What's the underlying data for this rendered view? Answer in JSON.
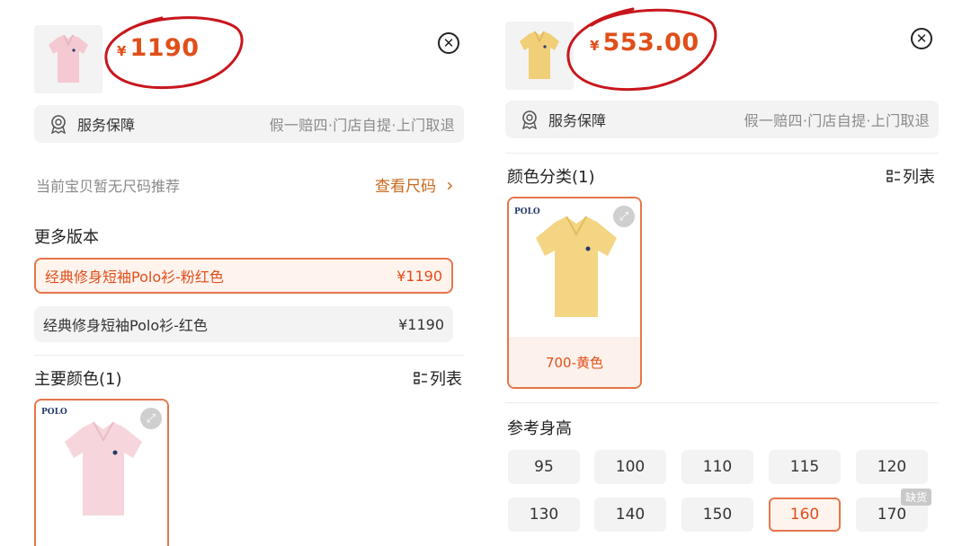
{
  "left": {
    "price": {
      "currency": "¥",
      "amount": "1190"
    },
    "close_icon": "close-circle-icon",
    "service": {
      "label": "服务保障",
      "detail": "假一赔四·门店自提·上门取退"
    },
    "size_recommend": {
      "text": "当前宝贝暂无尺码推荐",
      "link": "查看尺码",
      "link_arrow": "›"
    },
    "more_versions": {
      "title": "更多版本",
      "items": [
        {
          "name": "经典修身短袖Polo衫-粉红色",
          "price": "¥1190",
          "selected": true
        },
        {
          "name": "经典修身短袖Polo衫-红色",
          "price": "¥1190",
          "selected": false
        }
      ]
    },
    "main_color": {
      "title": "主要颜色(1)",
      "toggle": "列表",
      "brand": "POLO",
      "swatch_color": "#f6d6dc"
    }
  },
  "right": {
    "price": {
      "currency": "¥",
      "amount": "553.00"
    },
    "close_icon": "close-circle-icon",
    "service": {
      "label": "服务保障",
      "detail": "假一赔四·门店自提·上门取退"
    },
    "color_category": {
      "title": "颜色分类(1)",
      "toggle": "列表",
      "brand": "POLO",
      "caption": "700-黄色",
      "swatch_color": "#f3d584"
    },
    "height": {
      "title": "参考身高",
      "options": [
        {
          "label": "95",
          "selected": false
        },
        {
          "label": "100",
          "selected": false
        },
        {
          "label": "110",
          "selected": false
        },
        {
          "label": "115",
          "selected": false
        },
        {
          "label": "120",
          "selected": false
        },
        {
          "label": "130",
          "selected": false
        },
        {
          "label": "140",
          "selected": false
        },
        {
          "label": "150",
          "selected": false
        },
        {
          "label": "160",
          "selected": true
        },
        {
          "label": "170",
          "selected": false,
          "badge": "缺货"
        }
      ]
    }
  },
  "colors": {
    "accent": "#e04f1a",
    "accent_border": "#e5754a",
    "circle_red": "#c8161d",
    "link_orange": "#c9691e"
  }
}
